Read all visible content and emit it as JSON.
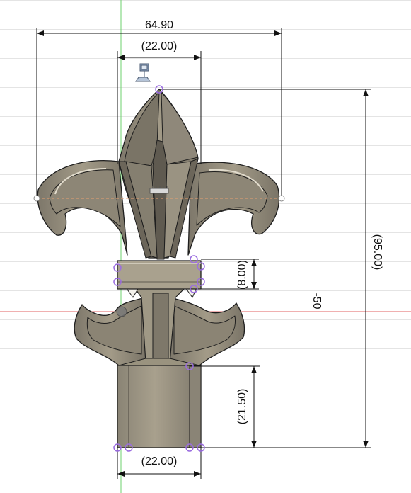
{
  "viewport": {
    "background": "#ffffff",
    "grid_color": "#e4e4e4",
    "x_axis_color": "#e06060",
    "y_axis_color": "#6cd06c",
    "sketch_centerline_color": "#e8a070",
    "sketch_point_color": "#9b6de0"
  },
  "dimensions": {
    "overall_width": "64.90",
    "top_width": "(22.00)",
    "bottom_width": "(22.00)",
    "overall_height": "(95.00)",
    "band_height": "(8.00)",
    "stem_height": "(21.50)",
    "offset": "-50"
  },
  "icons": {
    "ucs_icon": "sketch-plane-icon",
    "midpoint_icon": "midpoint-marker-icon"
  },
  "model": {
    "name": "fleur-de-lis finial",
    "body_color": "#9c9481",
    "shade_color": "#6f6a5e",
    "highlight_color": "#d8d2c2",
    "edge_color": "#1e1e1e"
  }
}
